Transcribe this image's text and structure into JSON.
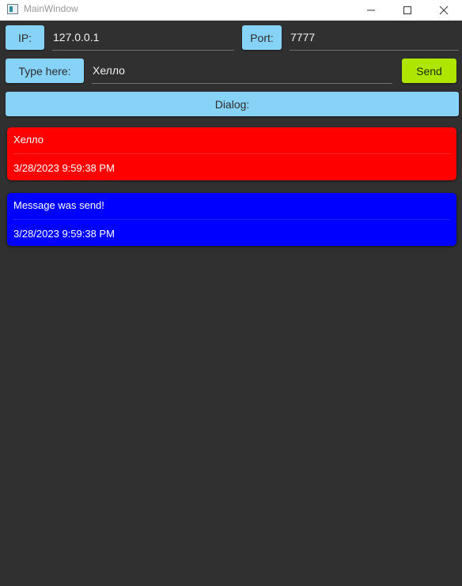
{
  "window": {
    "title": "MainWindow",
    "background": "#303030"
  },
  "connection": {
    "ip_label": "IP:",
    "ip_value": "127.0.0.1",
    "port_label": "Port:",
    "port_value": "7777"
  },
  "composer": {
    "type_label": "Type here:",
    "message_value": "Хелло",
    "send_label": "Send",
    "send_color": "#aee600"
  },
  "dialog": {
    "header_label": "Dialog:",
    "label_color": "#87d3f8",
    "messages": [
      {
        "text": "Хелло",
        "time": "3/28/2023 9:59:38 PM",
        "color": "#ff0000"
      },
      {
        "text": "Message was send!",
        "time": "3/28/2023 9:59:38 PM",
        "color": "#0000ff"
      }
    ]
  }
}
